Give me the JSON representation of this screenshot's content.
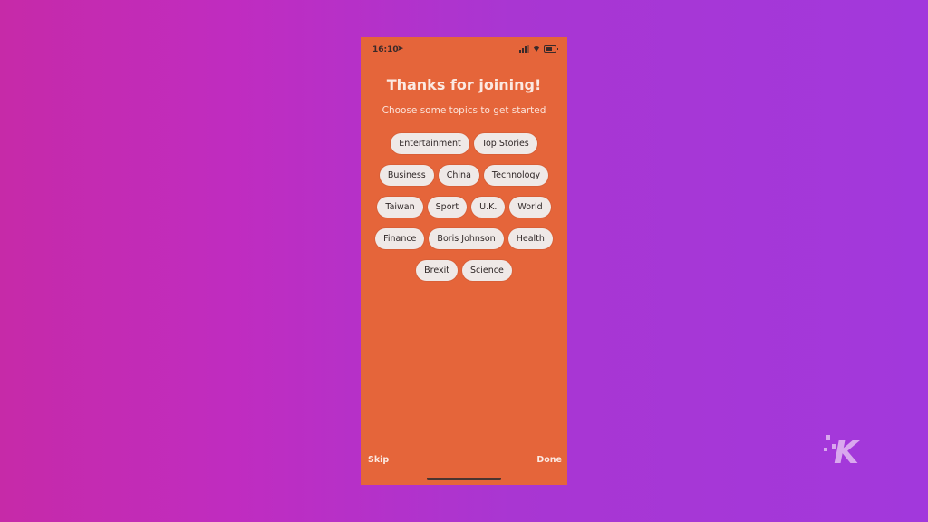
{
  "status_bar": {
    "time": "16:10",
    "location_icon": "location-arrow-icon",
    "signal_icon": "signal-icon",
    "wifi_icon": "wifi-icon",
    "battery_icon": "battery-icon"
  },
  "onboarding": {
    "title": "Thanks for joining!",
    "subtitle": "Choose some topics to get started",
    "topic_rows": [
      [
        "Entertainment",
        "Top Stories"
      ],
      [
        "Business",
        "China",
        "Technology"
      ],
      [
        "Taiwan",
        "Sport",
        "U.K.",
        "World"
      ],
      [
        "Finance",
        "Boris Johnson",
        "Health"
      ],
      [
        "Brexit",
        "Science"
      ]
    ]
  },
  "footer": {
    "skip_label": "Skip",
    "done_label": "Done"
  },
  "watermark": {
    "logo_letter": "K",
    "logo_icon": "knowtechie-logo-icon"
  },
  "colors": {
    "phone_background": "#e5653a",
    "chip_background": "#efe9e7",
    "page_gradient_start": "#c62aa8",
    "page_gradient_end": "#a238dc"
  }
}
